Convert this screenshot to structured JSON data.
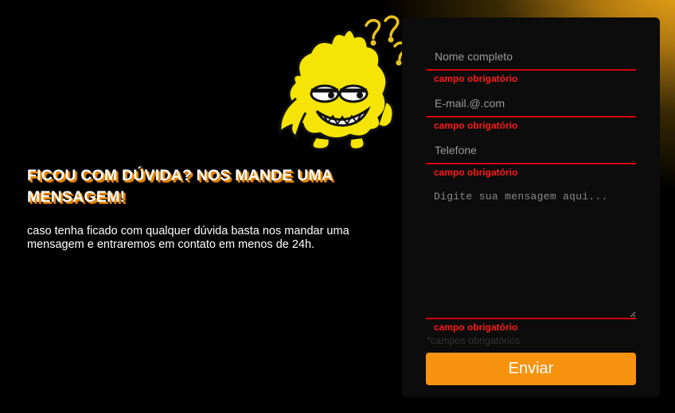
{
  "hero": {
    "headline": "FICOU COM DÚVIDA? NOS MANDE UMA MENSAGEM!",
    "subtext": "caso tenha ficado com qualquer dúvida basta nos mandar uma mensagem e entraremos em contato em menos de 24h."
  },
  "form": {
    "name_placeholder": "Nome completo",
    "email_placeholder": "E-mail.@.com",
    "phone_placeholder": "Telefone",
    "message_placeholder": "Digite sua mensagem aqui...",
    "error_text": "campo obrigatório",
    "required_note": "*campos obrigatórios",
    "submit_label": "Enviar"
  },
  "colors": {
    "accent": "#f7930f",
    "error": "#ff1a1a"
  }
}
